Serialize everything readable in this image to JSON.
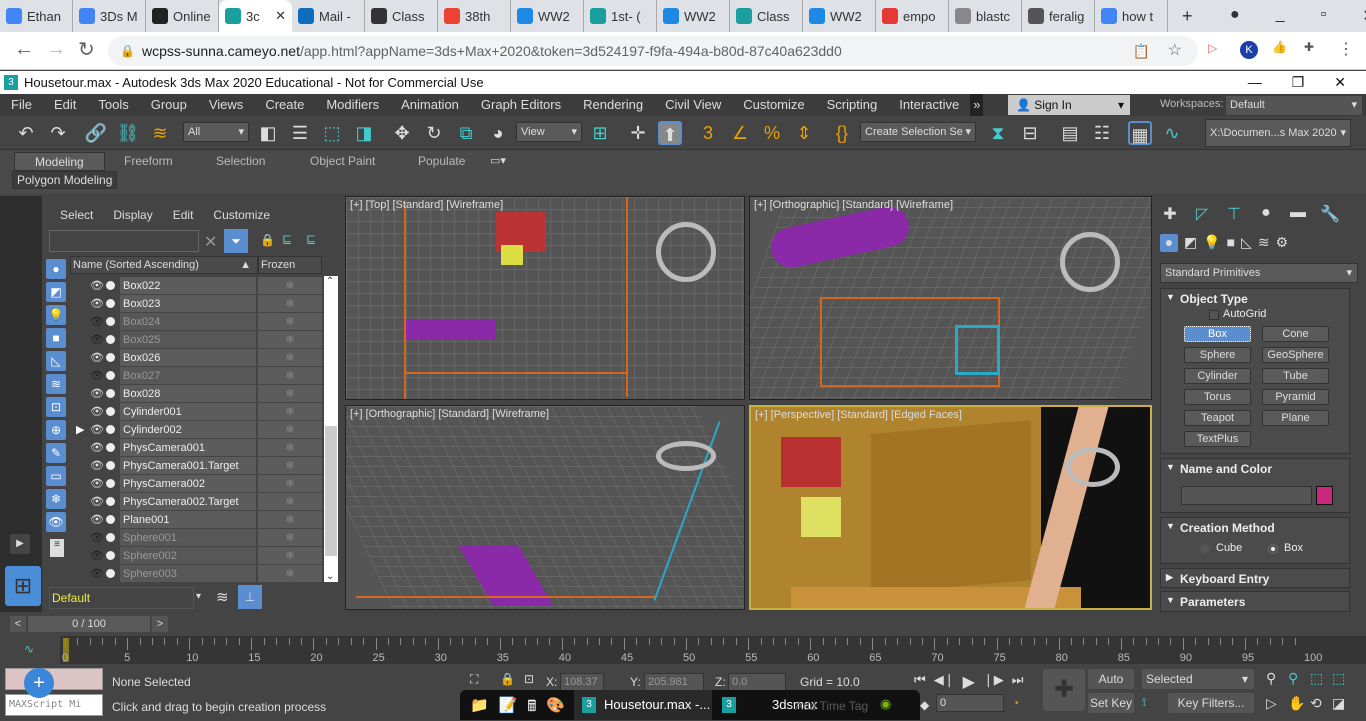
{
  "browser": {
    "tabs": [
      {
        "label": "Ethan",
        "icon": "docs-icon",
        "color": "#4285f4"
      },
      {
        "label": "3Ds M",
        "icon": "docs-icon",
        "color": "#4285f4"
      },
      {
        "label": "Online",
        "icon": "play-icon",
        "color": "#222"
      },
      {
        "label": "3c",
        "icon": "3dsmax-icon",
        "color": "#1a9e9e",
        "active": true
      },
      {
        "label": "Mail -",
        "icon": "outlook-icon",
        "color": "#0f6cbd"
      },
      {
        "label": "Class",
        "icon": "classroom-icon",
        "color": "#333"
      },
      {
        "label": "38th",
        "icon": "google-icon",
        "color": "#ea4335"
      },
      {
        "label": "WW2",
        "icon": "slides-icon",
        "color": "#1e88e5"
      },
      {
        "label": "1st- (",
        "icon": "classroom-icon",
        "color": "#1a9e9e"
      },
      {
        "label": "WW2",
        "icon": "slides-icon",
        "color": "#1e88e5"
      },
      {
        "label": "Class",
        "icon": "classroom-icon",
        "color": "#1a9e9e"
      },
      {
        "label": "WW2",
        "icon": "slides-icon",
        "color": "#1e88e5"
      },
      {
        "label": "empo",
        "icon": "bag-icon",
        "color": "#e53935"
      },
      {
        "label": "blastc",
        "icon": "blast-icon",
        "color": "#888"
      },
      {
        "label": "feralig",
        "icon": "globe-icon",
        "color": "#555"
      },
      {
        "label": "how t",
        "icon": "google-icon",
        "color": "#4285f4"
      }
    ],
    "url_host": "wcpss-sunna.cameyo.net",
    "url_path": "/app.html?appName=3ds+Max+2020&token=3d524197-f9fa-494a-b80d-87c40a623dd0"
  },
  "app": {
    "title": "Housetour.max - Autodesk 3ds Max 2020 Educational - Not for Commercial Use",
    "menu": [
      "File",
      "Edit",
      "Tools",
      "Group",
      "Views",
      "Create",
      "Modifiers",
      "Animation",
      "Graph Editors",
      "Rendering",
      "Civil View",
      "Customize",
      "Scripting",
      "Interactive"
    ],
    "sign_in": "Sign In",
    "workspaces_label": "Workspaces:",
    "workspace": "Default",
    "toolbar": {
      "selection_filter": "All",
      "ref_coord": "View",
      "named_selection": "Create Selection Se",
      "project_path": "X:\\Documen...s Max 2020"
    },
    "ribbon_tabs": [
      "Modeling",
      "Freeform",
      "Selection",
      "Object Paint",
      "Populate"
    ],
    "ribbon_panel": "Polygon Modeling"
  },
  "explorer": {
    "menu": [
      "Select",
      "Display",
      "Edit",
      "Customize"
    ],
    "search_value": "",
    "col_name": "Name (Sorted Ascending)",
    "col_frozen": "Frozen",
    "rows": [
      {
        "name": "Box022",
        "visible": true
      },
      {
        "name": "Box023",
        "visible": true
      },
      {
        "name": "Box024",
        "visible": false
      },
      {
        "name": "Box025",
        "visible": false
      },
      {
        "name": "Box026",
        "visible": true
      },
      {
        "name": "Box027",
        "visible": false
      },
      {
        "name": "Box028",
        "visible": true
      },
      {
        "name": "Cylinder001",
        "visible": true
      },
      {
        "name": "Cylinder002",
        "visible": true
      },
      {
        "name": "PhysCamera001",
        "visible": true
      },
      {
        "name": "PhysCamera001.Target",
        "visible": true
      },
      {
        "name": "PhysCamera002",
        "visible": true
      },
      {
        "name": "PhysCamera002.Target",
        "visible": true
      },
      {
        "name": "Plane001",
        "visible": true
      },
      {
        "name": "Sphere001",
        "visible": false
      },
      {
        "name": "Sphere002",
        "visible": false
      },
      {
        "name": "Sphere003",
        "visible": false
      }
    ],
    "layer": "Default"
  },
  "viewports": [
    {
      "label": "[+] [Top] [Standard] [Wireframe]"
    },
    {
      "label": "[+] [Orthographic] [Standard] [Wireframe]"
    },
    {
      "label": "[+] [Orthographic] [Standard] [Wireframe]"
    },
    {
      "label": "[+] [Perspective] [Standard] [Edged Faces]",
      "active": true
    }
  ],
  "command_panel": {
    "category": "Standard Primitives",
    "object_type": "Object Type",
    "autogrid": "AutoGrid",
    "buttons": [
      "Box",
      "Cone",
      "Sphere",
      "GeoSphere",
      "Cylinder",
      "Tube",
      "Torus",
      "Pyramid",
      "Teapot",
      "Plane",
      "TextPlus"
    ],
    "active_button": "Box",
    "name_color": "Name and Color",
    "object_color": "#c8297f",
    "creation_method": "Creation Method",
    "methods": [
      "Cube",
      "Box"
    ],
    "selected_method": "Box",
    "keyboard_entry": "Keyboard Entry",
    "parameters": "Parameters"
  },
  "timeline": {
    "frame": "0 / 100",
    "ticks": [
      "0",
      "5",
      "10",
      "15",
      "20",
      "25",
      "30",
      "35",
      "40",
      "45",
      "50",
      "55",
      "60",
      "65",
      "70",
      "75",
      "80",
      "85",
      "90",
      "95",
      "100"
    ]
  },
  "status": {
    "maxscript": "MAXScript Mi",
    "selection": "None Selected",
    "prompt": "Click and drag to begin creation process",
    "x_label": "X:",
    "x": "108.37",
    "y_label": "Y:",
    "y": "205.981",
    "z_label": "Z:",
    "z": "0.0",
    "grid": "Grid = 10.0",
    "auto_key": "Auto Key",
    "set_key": "Set Key",
    "key_mode": "Selected",
    "key_filters": "Key Filters...",
    "current_frame": "0",
    "time_tag": "Add Time Tag"
  },
  "taskbar": {
    "items": [
      "Housetour.max -...",
      "3dsmax"
    ]
  }
}
